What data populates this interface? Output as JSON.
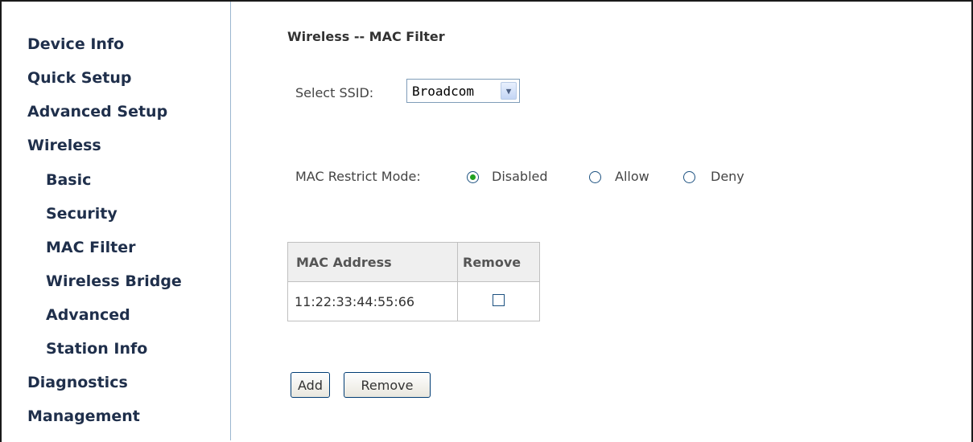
{
  "sidebar": {
    "items": [
      {
        "label": "Device Info"
      },
      {
        "label": "Quick Setup"
      },
      {
        "label": "Advanced Setup"
      },
      {
        "label": "Wireless"
      },
      {
        "label": "Basic"
      },
      {
        "label": "Security"
      },
      {
        "label": "MAC Filter"
      },
      {
        "label": "Wireless Bridge"
      },
      {
        "label": "Advanced"
      },
      {
        "label": "Station Info"
      },
      {
        "label": "Diagnostics"
      },
      {
        "label": "Management"
      }
    ]
  },
  "main": {
    "title": "Wireless -- MAC Filter",
    "ssid": {
      "label": "Select SSID:",
      "selected": "Broadcom"
    },
    "restrict_mode": {
      "label": "MAC Restrict Mode:",
      "options": [
        "Disabled",
        "Allow",
        "Deny"
      ],
      "selected": "Disabled"
    },
    "table": {
      "headers": [
        "MAC Address",
        "Remove"
      ],
      "rows": [
        {
          "mac": "11:22:33:44:55:66",
          "remove": false
        }
      ]
    },
    "buttons": {
      "add": "Add",
      "remove": "Remove"
    }
  },
  "colors": {
    "nav_text": "#1f2f4b",
    "radio_selected": "#21a121",
    "sidebar_border": "#9bb6cf"
  }
}
